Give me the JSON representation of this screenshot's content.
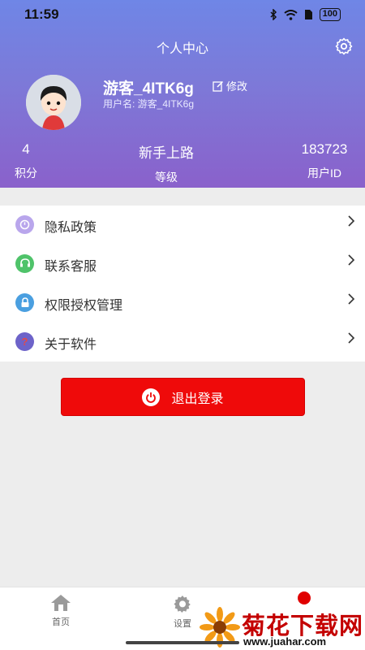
{
  "status_bar": {
    "time": "11:59",
    "battery": "100"
  },
  "header": {
    "title": "个人中心"
  },
  "profile": {
    "username": "游客_4ITK6g",
    "edit_label": "修改",
    "account_line": "用户名: 游客_4ITK6g"
  },
  "stats": [
    {
      "value": "4",
      "label": "积分"
    },
    {
      "value": "新手上路",
      "label": "等级"
    },
    {
      "value": "183723",
      "label": "用户ID"
    }
  ],
  "menu": [
    {
      "label": "隐私政策",
      "icon": "privacy-icon",
      "color": "#b9a6ec"
    },
    {
      "label": "联系客服",
      "icon": "customer-service-icon",
      "color": "#4fc36a"
    },
    {
      "label": "权限授权管理",
      "icon": "lock-icon",
      "color": "#4a9fe0"
    },
    {
      "label": "关于软件",
      "icon": "question-icon",
      "color": "#6d63c9"
    }
  ],
  "logout": {
    "label": "退出登录"
  },
  "tabbar": [
    {
      "label": "首页",
      "icon": "home-icon"
    },
    {
      "label": "设置",
      "icon": "gear-icon"
    }
  ],
  "watermark": {
    "title": "菊花下载网",
    "url": "www.juahar.com"
  },
  "colors": {
    "header_top": "#6f86e6",
    "header_bottom": "#8a61cb",
    "logout": "#ef0a0a"
  }
}
